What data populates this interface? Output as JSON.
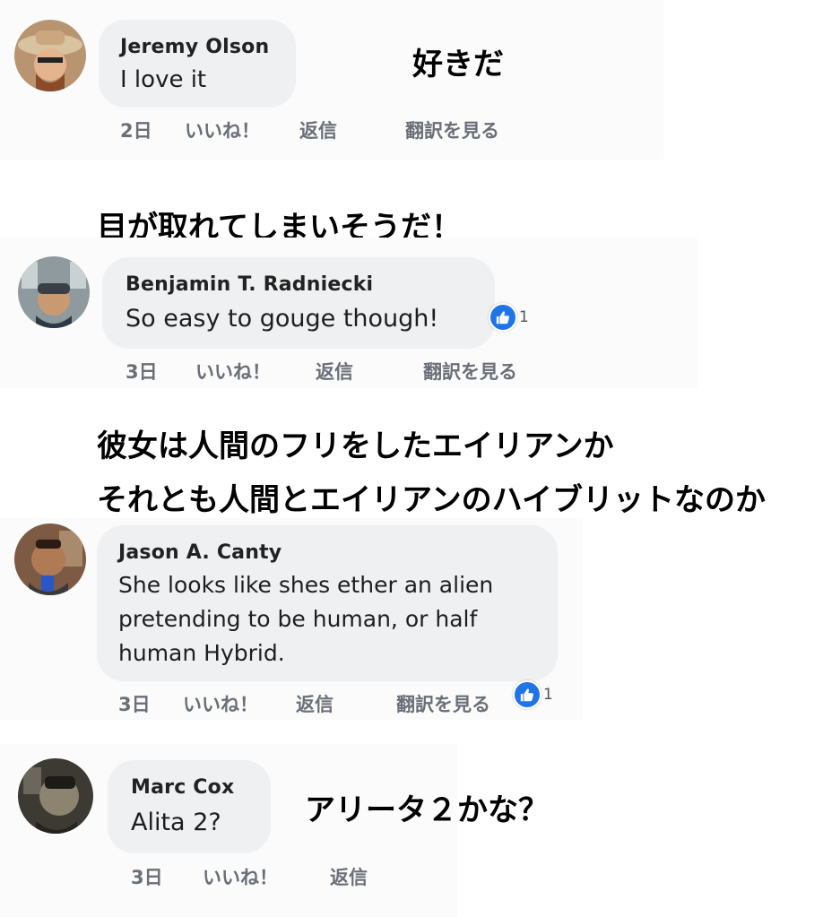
{
  "comments": [
    {
      "name": "Jeremy Olson",
      "text_lines": [
        "I love it"
      ],
      "time": "2日",
      "like": "いいね！",
      "reply": "返信",
      "translate": "翻訳を見る",
      "reactions": null
    },
    {
      "name": "Benjamin T. Radniecki",
      "text_lines": [
        "So easy to gouge though!"
      ],
      "time": "3日",
      "like": "いいね！",
      "reply": "返信",
      "translate": "翻訳を見る",
      "reactions": "1"
    },
    {
      "name": "Jason A. Canty",
      "text_lines": [
        "She looks like shes ether an alien",
        "pretending to be human, or half",
        "human Hybrid."
      ],
      "time": "3日",
      "like": "いいね！",
      "reply": "返信",
      "translate": "翻訳を見る",
      "reactions": "1"
    },
    {
      "name": "Marc Cox",
      "text_lines": [
        "Alita 2?"
      ],
      "time": "3日",
      "like": "いいね！",
      "reply": "返信",
      "translate": null,
      "reactions": null
    }
  ],
  "annotations": {
    "a1": "好きだ",
    "a2": "目が取れてしまいそうだ！",
    "a3_line1": "彼女は人間のフリをしたエイリアンか",
    "a3_line2": "それとも人間とエイリアンのハイブリットなのか",
    "a4": "アリータ２かな？"
  },
  "colors": {
    "bubble": "#eff0f2",
    "action_text": "#6a6f78",
    "like_blue": "#1f74e8"
  },
  "icons": [
    "like-thumb-icon"
  ]
}
